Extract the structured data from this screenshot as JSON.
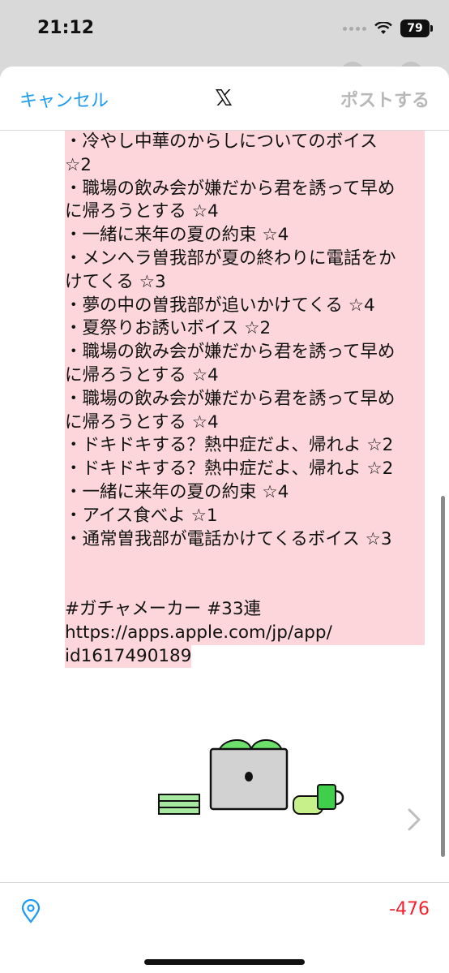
{
  "status": {
    "time": "21:12",
    "battery": "79"
  },
  "nav": {
    "cancel_label": "キャンセル",
    "post_label": "ポストする"
  },
  "post_lines": [
    "・冷やし中華のからしについてのボイス",
    "☆2",
    "・職場の飲み会が嫌だから君を誘って早め",
    "に帰ろうとする ☆4",
    "・一緒に来年の夏の約束 ☆4",
    "・メンヘラ曽我部が夏の終わりに電話をか",
    "けてくる ☆3",
    "・夢の中の曽我部が追いかけてくる ☆4",
    "・夏祭りお誘いボイス ☆2",
    "・職場の飲み会が嫌だから君を誘って早め",
    "に帰ろうとする ☆4",
    "・職場の飲み会が嫌だから君を誘って早め",
    "に帰ろうとする ☆4",
    "・ドキドキする？熱中症だよ、帰れよ ☆2",
    "・ドキドキする？熱中症だよ、帰れよ ☆2",
    "・一緒に来年の夏の約束 ☆4",
    "・アイス食べよ ☆1",
    "・通常曽我部が電話かけてくるボイス ☆3"
  ],
  "tail_lines": [
    "#ガチャメーカー #33連",
    "https://apps.apple.com/jp/app/",
    "id1617490189"
  ],
  "stars": [
    "★",
    "★"
  ],
  "char_count": "-476",
  "colors": {
    "accent": "#1d9bf0",
    "highlight": "#fcd6da",
    "count": "#f4212e"
  }
}
